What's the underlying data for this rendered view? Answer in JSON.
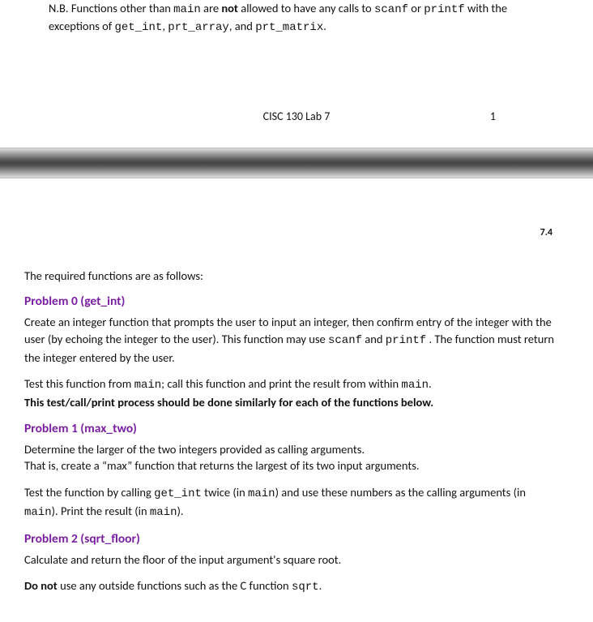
{
  "page1": {
    "nb_part1": "N.B. Functions other than ",
    "nb_main": "main",
    "nb_part2": " are ",
    "nb_not": "not",
    "nb_part3": " allowed to have any calls to ",
    "nb_scanf": "scanf",
    "nb_part4": " or ",
    "nb_printf": "printf",
    "nb_part5": " with the exceptions of ",
    "nb_getint": "get_int",
    "nb_comma1": ", ",
    "nb_prtarray": "prt_array",
    "nb_part6": ", and ",
    "nb_prtmatrix": "prt_matrix",
    "nb_part7": ".",
    "footer_title": "CISC 130 Lab 7",
    "footer_pagenum": "1"
  },
  "page2": {
    "top_right": "7.4",
    "intro": "The required functions are as follows:",
    "p0": {
      "heading": "Problem 0 (get_int)",
      "desc_1": "Create an integer function that prompts the user to input an integer, then confirm entry of the integer with the user (by echoing the integer to the user). This function may use ",
      "scanf": "scanf",
      "desc_2": " and ",
      "printf": "printf",
      "desc_3": " . The function must return the integer entered by the user.",
      "test_1": "Test this function from ",
      "main1": "main",
      "test_2": "; call this function and print the result from within ",
      "main2": "main",
      "test_3": ".",
      "bold_note": "This test/call/print process should be done similarly for each of the functions below."
    },
    "p1": {
      "heading": "Problem 1 (max_two)",
      "l1": "Determine the larger of the two integers provided as calling arguments.",
      "l2": "That is, create a “max” function that returns the largest of its two input arguments.",
      "t1": "Test the function by calling ",
      "getint": "get_int",
      "t2": " twice (in ",
      "main1": "main",
      "t3": ") and use these numbers as the calling arguments (in ",
      "main2": "main",
      "t4": "). Print the result (in ",
      "main3": "main",
      "t5": ")."
    },
    "p2": {
      "heading": "Problem 2 (sqrt_floor)",
      "l1": "Calculate and return the floor of the input argument's square root.",
      "dn1": "Do not",
      "dn2": " use any outside functions such as the C function ",
      "sqrt": "sqrt",
      "dn3": "."
    }
  }
}
